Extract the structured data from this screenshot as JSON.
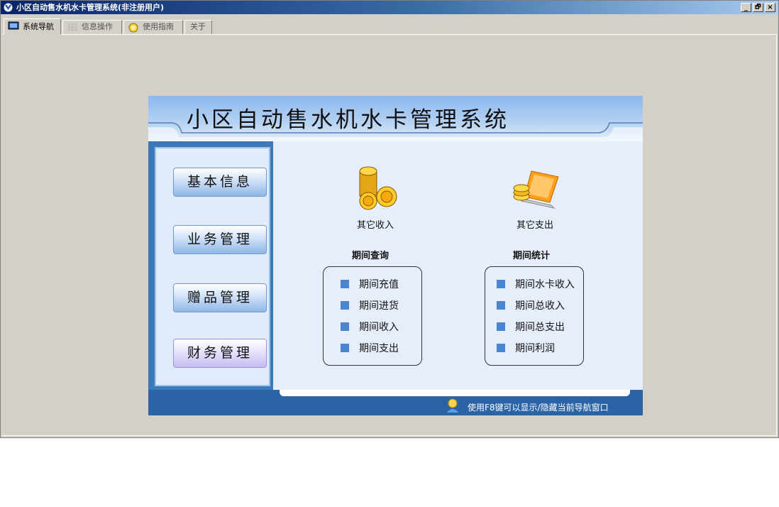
{
  "window": {
    "title": "小区自动售水机水卡管理系统(非注册用户)",
    "controls": [
      "_",
      "🗗",
      "×"
    ]
  },
  "tabs": [
    {
      "label": "系统导航",
      "active": true
    },
    {
      "label": "信息操作",
      "active": false
    },
    {
      "label": "使用指南",
      "active": false
    },
    {
      "label": "关于",
      "active": false
    }
  ],
  "banner": {
    "title": "小区自动售水机水卡管理系统"
  },
  "sidebar": {
    "items": [
      {
        "label": "基本信息"
      },
      {
        "label": "业务管理"
      },
      {
        "label": "赠品管理"
      },
      {
        "label": "财务管理",
        "selected": true
      }
    ]
  },
  "features": {
    "income": "其它收入",
    "expense": "其它支出"
  },
  "query": {
    "title": "期间查询",
    "items": [
      "期间充值",
      "期间进货",
      "期间收入",
      "期间支出"
    ]
  },
  "stats": {
    "title": "期间统计",
    "items": [
      "期间水卡收入",
      "期间总收入",
      "期间总支出",
      "期间利润"
    ]
  },
  "footer": {
    "hint": "使用F8键可以显示/隐藏当前导航窗口"
  },
  "colors": {
    "accent": "#2a64a6",
    "bullet": "#4a86d0"
  }
}
